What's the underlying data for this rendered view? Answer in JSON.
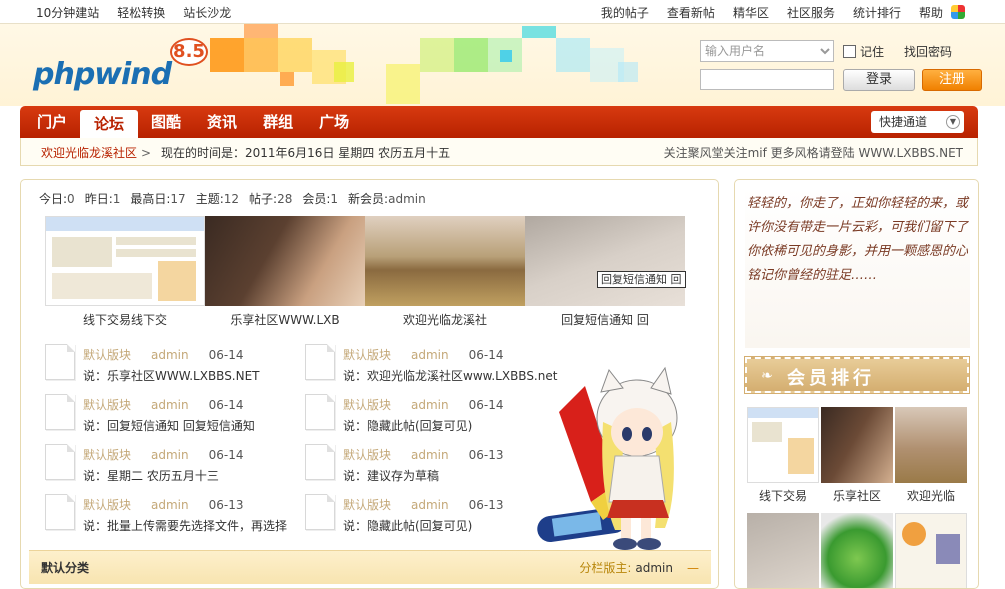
{
  "top_links": {
    "left": [
      "10分钟建站",
      "轻松转换",
      "站长沙龙"
    ],
    "right": [
      "我的帖子",
      "查看新帖",
      "精华区",
      "社区服务",
      "统计排行",
      "帮助"
    ]
  },
  "header": {
    "logo": "phpwind",
    "version": "8.5"
  },
  "login": {
    "username_placeholder": "输入用户名",
    "remember_label": "记住",
    "find_password": "找回密码",
    "login_button": "登录",
    "register_button": "注册"
  },
  "nav": {
    "items": [
      "门户",
      "论坛",
      "图酷",
      "资讯",
      "群组",
      "广场"
    ],
    "active": "论坛",
    "quick_access": "快捷通道"
  },
  "subnav": {
    "breadcrumb": "欢迎光临龙溪社区",
    "breadcrumb_sep": ">",
    "time": "现在的时间是：2011年6月16日 星期四 农历五月十五",
    "right": "关注聚风堂关注mif 更多风格请登陆 WWW.LXBBS.NET"
  },
  "stats": [
    {
      "label": "今日:",
      "value": "0"
    },
    {
      "label": "昨日:",
      "value": "1"
    },
    {
      "label": "最高日:",
      "value": "17"
    },
    {
      "label": "主题:",
      "value": "12"
    },
    {
      "label": "帖子:",
      "value": "28"
    },
    {
      "label": "会员:",
      "value": "1"
    },
    {
      "label": "新会员:",
      "value": "admin"
    }
  ],
  "photos": [
    {
      "caption": "线下交易线下交"
    },
    {
      "caption": "乐享社区WWW.LXB"
    },
    {
      "caption": "欢迎光临龙溪社"
    },
    {
      "caption": "回复短信通知 回"
    }
  ],
  "tooltip": "回复短信通知 回",
  "posts": [
    {
      "forum": "默认版块",
      "author": "admin",
      "date": "06-14",
      "text": "说：乐享社区WWW.LXBBS.NET"
    },
    {
      "forum": "默认版块",
      "author": "admin",
      "date": "06-14",
      "text": "说：欢迎光临龙溪社区www.LXBBS.net"
    },
    {
      "forum": "默认版块",
      "author": "admin",
      "date": "06-14",
      "text": "说：回复短信通知 回复短信通知"
    },
    {
      "forum": "默认版块",
      "author": "admin",
      "date": "06-14",
      "text": "说：隐藏此帖(回复可见)"
    },
    {
      "forum": "默认版块",
      "author": "admin",
      "date": "06-14",
      "text": "说：星期二 农历五月十三"
    },
    {
      "forum": "默认版块",
      "author": "admin",
      "date": "06-13",
      "text": "说：建议存为草稿"
    },
    {
      "forum": "默认版块",
      "author": "admin",
      "date": "06-13",
      "text": "说：批量上传需要先选择文件，再选择"
    },
    {
      "forum": "默认版块",
      "author": "admin",
      "date": "06-13",
      "text": "说：隐藏此帖(回复可见)"
    }
  ],
  "category": {
    "title": "默认分类",
    "moderator_label": "分栏版主:",
    "moderator": "admin",
    "collapse": "—"
  },
  "sidebar": {
    "poem": "轻轻的，你走了，正如你轻轻的来，或许你没有带走一片云彩，可我们留下了你依稀可见的身影，并用一颗感恩的心铭记你曾经的驻足……",
    "rank_title": "会员排行",
    "members": [
      {
        "name": "线下交易"
      },
      {
        "name": "乐享社区"
      },
      {
        "name": "欢迎光临"
      }
    ]
  },
  "colors": {
    "nav_red": "#c02c06",
    "register_orange": "#f08000",
    "accent_tan": "#d4ae70"
  }
}
